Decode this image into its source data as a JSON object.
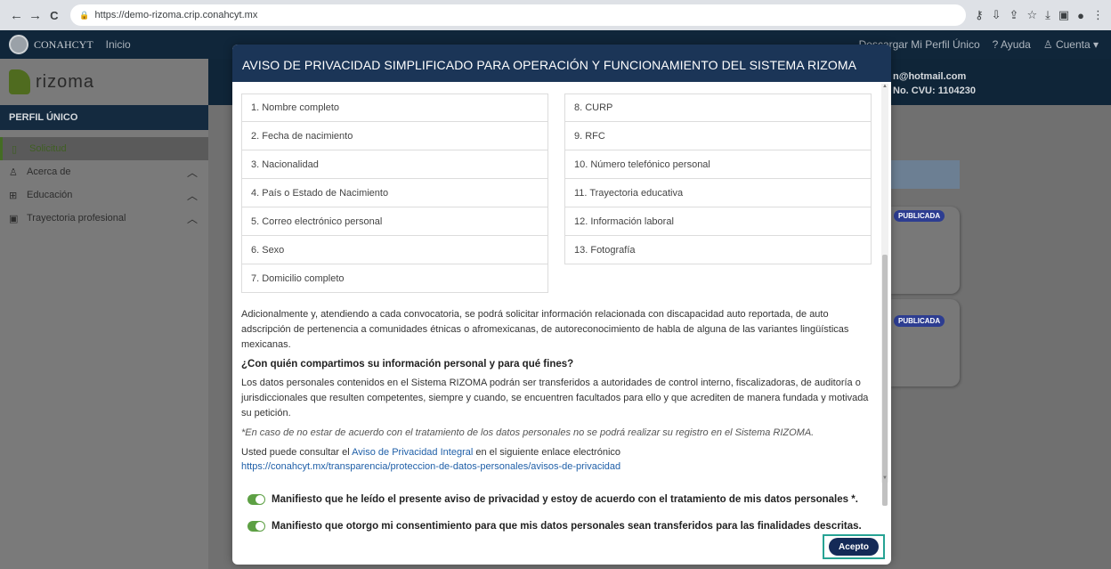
{
  "browser": {
    "url": "https://demo-rizoma.crip.conahcyt.mx",
    "nav": [
      "←",
      "→",
      "C"
    ]
  },
  "topnav": {
    "brand": "CONAHCYT",
    "inicio": "Inicio",
    "download": "Descargar Mi Perfil Único",
    "help": "Ayuda",
    "account": "Cuenta"
  },
  "sidebar": {
    "logo_text": "rizoma",
    "section": "PERFIL ÚNICO",
    "items": [
      {
        "label": "Solicitud",
        "icon": "document-icon"
      },
      {
        "label": "Acerca de",
        "icon": "user-icon"
      },
      {
        "label": "Educación",
        "icon": "book-icon"
      },
      {
        "label": "Trayectoria profesional",
        "icon": "badge-icon"
      }
    ]
  },
  "user": {
    "email": "n@hotmail.com",
    "cvu": "No. CVU: 1104230"
  },
  "badges": [
    "PUBLICADA",
    "PUBLICADA"
  ],
  "modal": {
    "title": "AVISO DE PRIVACIDAD SIMPLIFICADO PARA OPERACIÓN Y FUNCIONAMIENTO DEL SISTEMA RIZOMA",
    "left_items": [
      "1. Nombre completo",
      "2. Fecha de nacimiento",
      "3. Nacionalidad",
      "4. País o Estado de Nacimiento",
      "5. Correo electrónico personal",
      "6. Sexo",
      "7. Domicilio completo"
    ],
    "right_items": [
      "8. CURP",
      "9. RFC",
      "10. Número telefónico personal",
      "11. Trayectoria educativa",
      "12. Información laboral",
      "13. Fotografía"
    ],
    "paragraph1": "Adicionalmente y, atendiendo a cada convocatoria, se podrá solicitar información relacionada con discapacidad auto reportada, de auto adscripción de pertenencia a comunidades étnicas o afromexicanas, de autoreconocimiento de habla de alguna de las variantes lingüísticas mexicanas.",
    "question": "¿Con quién compartimos su información personal y para qué fines?",
    "paragraph2": "Los datos personales contenidos en el Sistema RIZOMA podrán ser transferidos a autoridades de control interno, fiscalizadoras, de auditoría o jurisdiccionales que resulten competentes, siempre y cuando, se encuentren facultados para ello y que acrediten de manera fundada y motivada su petición.",
    "note": "*En caso de no estar de acuerdo con el tratamiento de los datos personales no se podrá realizar su registro en el Sistema RIZOMA.",
    "consult_pre": "Usted puede consultar el ",
    "consult_link": "Aviso de Privacidad Integral",
    "consult_post": " en el siguiente enlace electrónico",
    "url_link": "https://conahcyt.mx/transparencia/proteccion-de-datos-personales/avisos-de-privacidad",
    "consent1": "Manifiesto que he leído el presente aviso de privacidad y estoy de acuerdo con el tratamiento de mis datos personales *.",
    "consent2": "Manifiesto que otorgo mi consentimiento para que mis datos personales sean transferidos para las finalidades descritas.",
    "accept": "Acepto"
  },
  "colors": {
    "modal_header": "#1b3557",
    "toggle_on": "#5da044",
    "accept_btn": "#142a57",
    "accept_focus": "#27a394"
  }
}
